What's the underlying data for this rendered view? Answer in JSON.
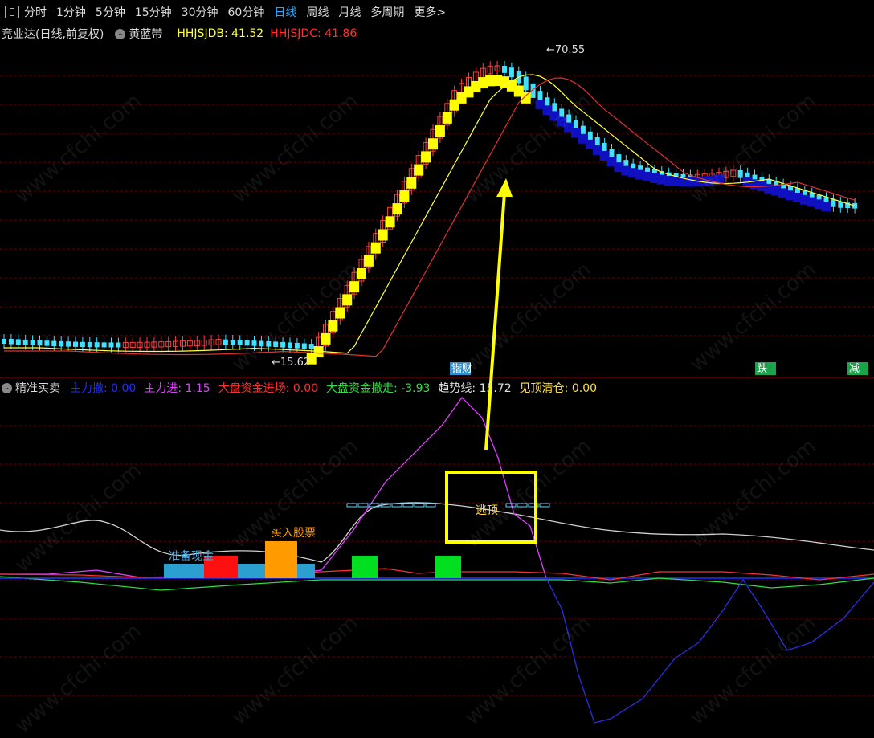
{
  "toolbar": {
    "tabs": [
      {
        "label": "分时"
      },
      {
        "label": "1分钟"
      },
      {
        "label": "5分钟"
      },
      {
        "label": "15分钟"
      },
      {
        "label": "30分钟"
      },
      {
        "label": "60分钟"
      },
      {
        "label": "日线"
      },
      {
        "label": "周线"
      },
      {
        "label": "月线"
      },
      {
        "label": "多周期"
      },
      {
        "label": "更多>"
      }
    ],
    "active_tab": "日线"
  },
  "main_chart": {
    "title": "竞业达(日线,前复权)",
    "indicator": "黄蓝带",
    "hhjsjdb_label": "HHJSJDB: 41.52",
    "hhjsjdc_label": "HHJSJDC: 41.86",
    "high_label": "70.55",
    "low_label": "15.62",
    "markers": [
      {
        "text": "锴财",
        "color": "#2a8fd0"
      },
      {
        "text": "跌",
        "color": "#1aa34a"
      },
      {
        "text": "减",
        "color": "#1aa34a"
      }
    ]
  },
  "sub_chart": {
    "title": "精准买卖",
    "fields": [
      {
        "text": "主力撤: 0.00",
        "color": "#2030ff"
      },
      {
        "text": "主力进: 1.15",
        "color": "#e040ff"
      },
      {
        "text": "大盘资金进场: 0.00",
        "color": "#ff3030"
      },
      {
        "text": "大盘资金撤走: -3.93",
        "color": "#30e040"
      },
      {
        "text": "趋势线: 15.72",
        "color": "#e0e0e0"
      },
      {
        "text": "见顶清仓: 0.00",
        "color": "#ffe040"
      }
    ],
    "annotations": {
      "prepare_cash": "准备现金",
      "buy_stock": "买入股票",
      "escape_top": "逃顶"
    }
  },
  "watermark": "www.cfchi.com",
  "colors": {
    "up": "#ff4040",
    "down": "#40e0ff",
    "yellow_band": "#ffff00",
    "blue_band": "#1010c0",
    "ma1": "#ffff40",
    "ma2": "#e03030",
    "grid": "#8b0000"
  }
}
